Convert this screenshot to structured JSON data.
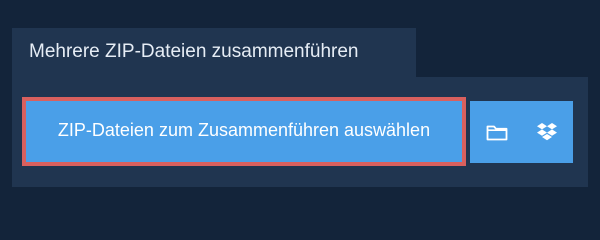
{
  "tab": {
    "title": "Mehrere ZIP-Dateien zusammenführen"
  },
  "uploader": {
    "select_button_label": "ZIP-Dateien zum Zusammenführen auswählen",
    "folder_icon": "folder-icon",
    "dropbox_icon": "dropbox-icon"
  },
  "colors": {
    "background": "#13243a",
    "panel": "#203550",
    "button": "#4a9fe8",
    "highlight_border": "#d9605e"
  }
}
